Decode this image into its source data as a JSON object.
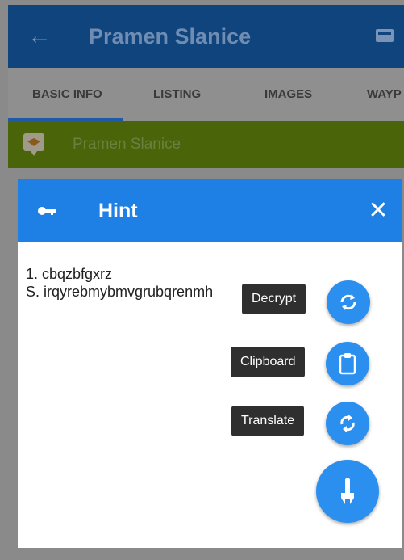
{
  "appbar": {
    "title": "Pramen Slanice",
    "back_icon": "arrow-left-icon",
    "action_icon": "inbox-icon"
  },
  "tabs": [
    {
      "label": "BASIC INFO",
      "selected": true
    },
    {
      "label": "LISTING",
      "selected": false
    },
    {
      "label": "IMAGES",
      "selected": false
    },
    {
      "label": "WAYP",
      "selected": false
    }
  ],
  "cache": {
    "name": "Pramen Slanice",
    "icon": "geocache-icon"
  },
  "dialog": {
    "title": "Hint",
    "icon": "key-icon",
    "close_icon": "close-icon",
    "text": "1. cbqzbfgxrz\nS. irqyrebmybmvgrubqrenmh"
  },
  "actions": [
    {
      "label": "Decrypt",
      "icon": "decrypt-icon"
    },
    {
      "label": "Clipboard",
      "icon": "clipboard-icon"
    },
    {
      "label": "Translate",
      "icon": "translate-icon"
    }
  ],
  "main_fab": {
    "icon": "tools-icon"
  },
  "colors": {
    "appbar": "#0f447d",
    "dialog_header": "#1e80e4",
    "fab": "#2b8ff0",
    "strip": "#4a6409"
  }
}
